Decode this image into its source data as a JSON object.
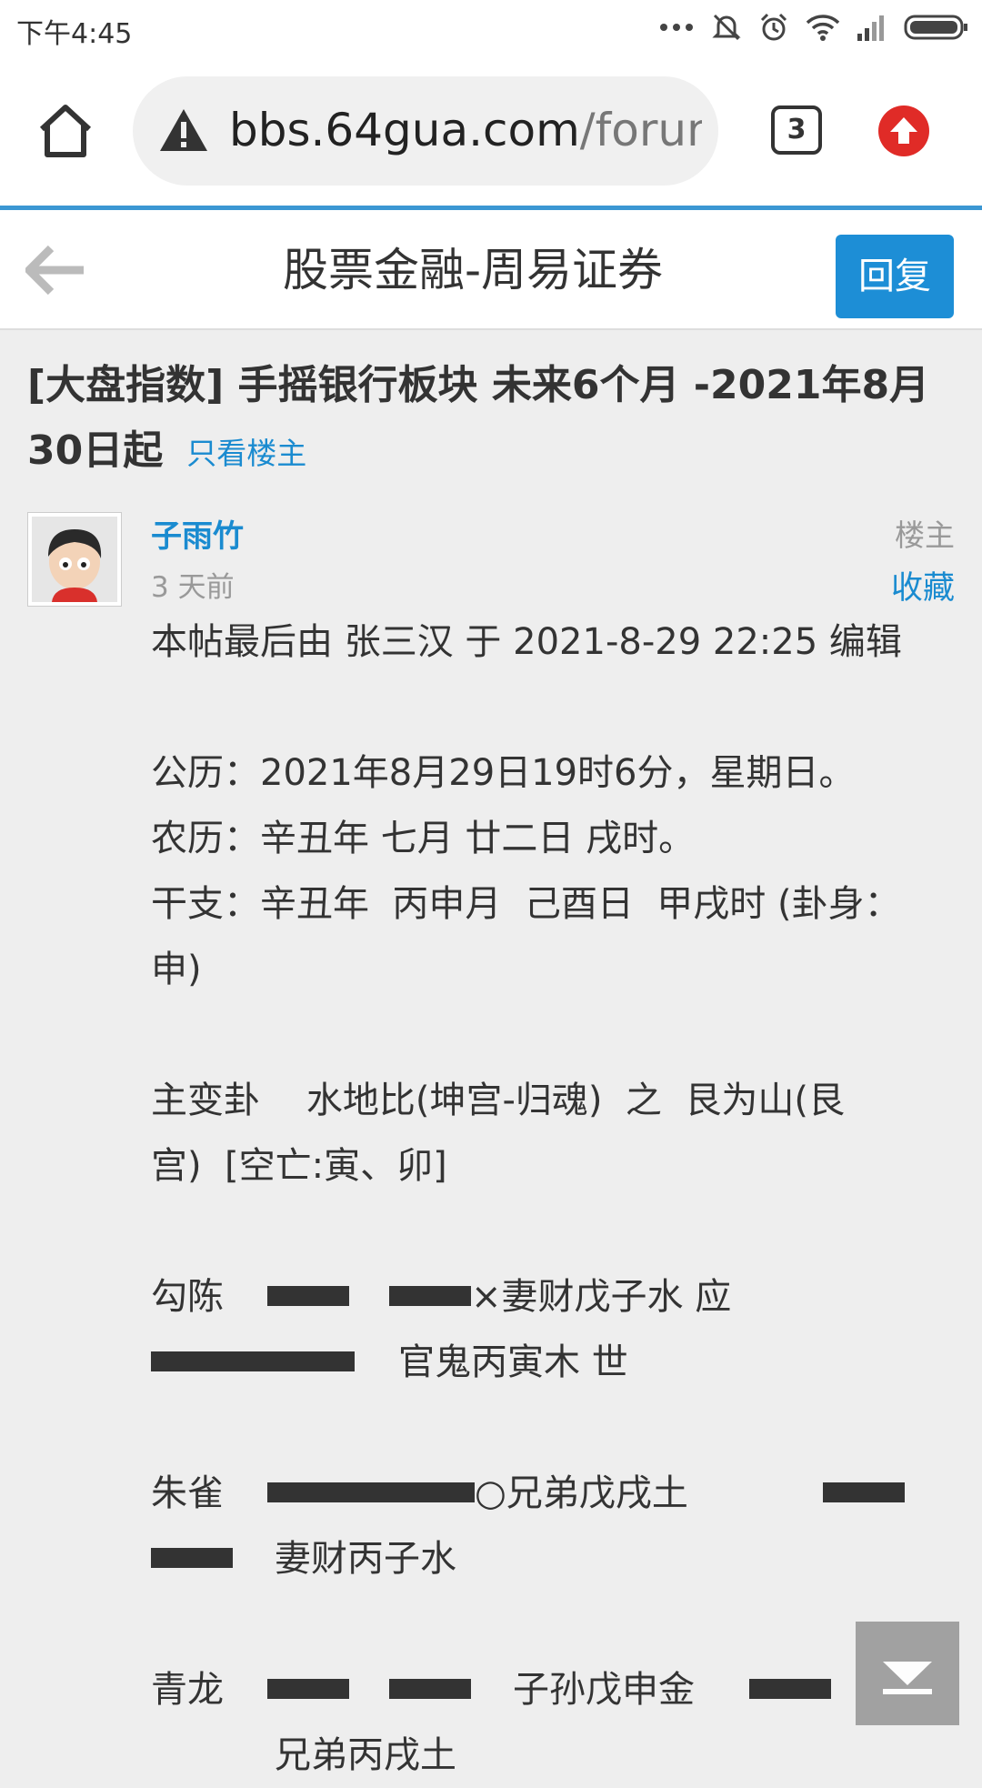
{
  "status_bar": {
    "time": "下午4:45",
    "icons": [
      "more-icon",
      "mute-icon",
      "alarm-icon",
      "wifi-icon",
      "signal-icon",
      "battery-icon"
    ]
  },
  "browser": {
    "url_host": "bbs.64gua.com",
    "url_path": "/forum.p",
    "tab_count": "3",
    "accent_color": "#3b97d3"
  },
  "forum": {
    "title": "股票金融-周易证券",
    "reply_label": "回复",
    "reply_color": "#1d8ed6"
  },
  "thread": {
    "title": "[大盘指数] 手摇银行板块 未来6个月 -2021年8月30日起",
    "only_op_label": "只看楼主"
  },
  "post": {
    "author": "子雨竹",
    "time": "3 天前",
    "op_label": "楼主",
    "favorite_label": "收藏",
    "lines": {
      "edit_note": "本帖最后由 张三汉 于 2021-8-29 22:25 编辑",
      "gongli": "公历：2021年8月29日19时6分，星期日。",
      "nongli": "农历：辛丑年 七月 廿二日 戌时。",
      "ganzhi_1": "干支：辛丑年  丙申月  己酉日  甲戌时 (卦身：",
      "ganzhi_2": "申)",
      "gua_1": "主变卦    水地比(坤宫-归魂)  之  艮为山(艮",
      "gua_2": "宫)  [空亡:寅、卯]",
      "r1_label": "勾陈",
      "r1_text": "×妻财戊子水 应",
      "r2_text": "官鬼丙寅木 世",
      "r3_label": "朱雀",
      "r3_text": "○兄弟戊戌土",
      "r4_text": "妻财丙子水",
      "r5_label": "青龙",
      "r5_text": "子孙戊申金",
      "r6_text": "兄弟丙戌土"
    }
  },
  "link_color": "#1a8bd0"
}
